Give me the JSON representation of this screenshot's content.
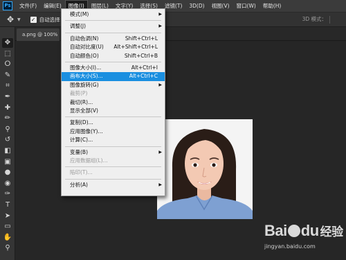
{
  "app": {
    "logo": "Ps"
  },
  "menubar": [
    {
      "label": "文件(F)"
    },
    {
      "label": "编辑(E)"
    },
    {
      "label": "图像(I)",
      "active": true
    },
    {
      "label": "图层(L)"
    },
    {
      "label": "文字(Y)"
    },
    {
      "label": "选择(S)"
    },
    {
      "label": "滤镜(T)"
    },
    {
      "label": "3D(D)"
    },
    {
      "label": "视图(V)"
    },
    {
      "label": "窗口(W)"
    },
    {
      "label": "帮助(H)"
    }
  ],
  "options_bar": {
    "auto_select_label": "自动选择：",
    "mode_3d": "3D 模式："
  },
  "document_tab": {
    "label": "a.png @ 100% (图"
  },
  "image_menu": [
    {
      "label": "模式(M)",
      "submenu": true
    },
    {
      "separator": true
    },
    {
      "label": "调整(J)",
      "submenu": true
    },
    {
      "separator": true
    },
    {
      "label": "自动色调(N)",
      "shortcut": "Shift+Ctrl+L"
    },
    {
      "label": "自动对比度(U)",
      "shortcut": "Alt+Shift+Ctrl+L"
    },
    {
      "label": "自动颜色(O)",
      "shortcut": "Shift+Ctrl+B"
    },
    {
      "separator": true
    },
    {
      "label": "图像大小(I)...",
      "shortcut": "Alt+Ctrl+I"
    },
    {
      "label": "画布大小(S)...",
      "shortcut": "Alt+Ctrl+C",
      "highlighted": true
    },
    {
      "label": "图像旋转(G)",
      "submenu": true
    },
    {
      "label": "裁剪(P)",
      "disabled": true
    },
    {
      "label": "裁切(R)..."
    },
    {
      "label": "显示全部(V)"
    },
    {
      "separator": true
    },
    {
      "label": "复制(D)..."
    },
    {
      "label": "应用图像(Y)..."
    },
    {
      "label": "计算(C)..."
    },
    {
      "separator": true
    },
    {
      "label": "变量(B)",
      "submenu": true
    },
    {
      "label": "应用数据组(L)...",
      "disabled": true
    },
    {
      "separator": true
    },
    {
      "label": "陷印(T)...",
      "disabled": true
    },
    {
      "separator": true
    },
    {
      "label": "分析(A)",
      "submenu": true
    }
  ],
  "tools": [
    "move-tool-icon",
    "marquee-tool-icon",
    "lasso-tool-icon",
    "quick-select-tool-icon",
    "crop-tool-icon",
    "eyedropper-tool-icon",
    "healing-brush-tool-icon",
    "brush-tool-icon",
    "clone-stamp-tool-icon",
    "history-brush-tool-icon",
    "eraser-tool-icon",
    "gradient-tool-icon",
    "blur-tool-icon",
    "dodge-tool-icon",
    "pen-tool-icon",
    "type-tool-icon",
    "path-select-tool-icon",
    "rectangle-tool-icon",
    "hand-tool-icon",
    "zoom-tool-icon"
  ],
  "watermark": {
    "brand_a": "Bai",
    "brand_b": "du",
    "brand_cn": "经验",
    "url": "jingyan.baidu.com"
  },
  "colors": {
    "highlight": "#1a8fe0",
    "menubar": "#3b3b3b",
    "canvas": "#262626",
    "photo_bg": "#f4f4f4",
    "shirt": "#7ea0d2"
  }
}
